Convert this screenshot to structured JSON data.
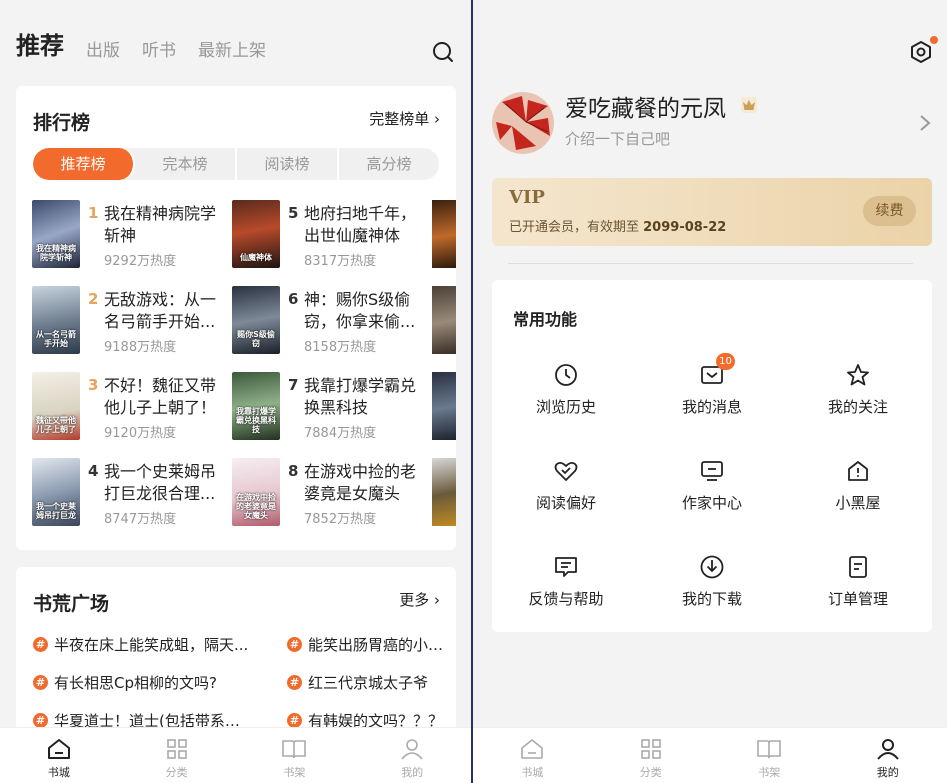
{
  "left": {
    "tabs": [
      {
        "label": "推荐",
        "active": true
      },
      {
        "label": "出版",
        "active": false
      },
      {
        "label": "听书",
        "active": false
      },
      {
        "label": "最新上架",
        "active": false
      }
    ],
    "ranking": {
      "title": "排行榜",
      "full_list": "完整榜单",
      "subtabs": [
        "推荐榜",
        "完本榜",
        "阅读榜",
        "高分榜"
      ],
      "books": [
        {
          "rank": "1",
          "title": "我在精神病院学斩神",
          "heat": "9292万热度",
          "cover_text": "我在精神病院学斩神"
        },
        {
          "rank": "2",
          "title": "无敌游戏：从一名弓箭手开始...",
          "heat": "9188万热度",
          "cover_text": "从一名弓箭手开始"
        },
        {
          "rank": "3",
          "title": "不好！魏征又带他儿子上朝了！",
          "heat": "9120万热度",
          "cover_text": "魏征又带他儿子上朝了"
        },
        {
          "rank": "4",
          "title": "我一个史莱姆吊打巨龙很合理...",
          "heat": "8747万热度",
          "cover_text": "我一个史莱姆吊打巨龙"
        },
        {
          "rank": "5",
          "title": "地府扫地千年，出世仙魔神体",
          "heat": "8317万热度",
          "cover_text": "仙魔神体"
        },
        {
          "rank": "6",
          "title": "神：赐你S级偷窃，你拿来偷...",
          "heat": "8158万热度",
          "cover_text": "赐你S级偷窃"
        },
        {
          "rank": "7",
          "title": "我靠打爆学霸兑换黑科技",
          "heat": "7884万热度",
          "cover_text": "我靠打爆学霸兑换黑科技"
        },
        {
          "rank": "8",
          "title": "在游戏中捡的老婆竟是女魔头",
          "heat": "7852万热度",
          "cover_text": "在游戏中捡的老婆竟是女魔头"
        }
      ]
    },
    "square": {
      "title": "书荒广场",
      "more": "更多",
      "topics": [
        "半夜在床上能笑成蛆，隔天...",
        "能笑出肠胃癌的小说，",
        "有长相思Cp相柳的文吗?",
        "红三代京城太子爷",
        "华夏道士！道士(包括带系统...",
        "有韩娱的文吗？？？"
      ]
    },
    "tabbar": [
      {
        "label": "书城",
        "active": true
      },
      {
        "label": "分类",
        "active": false
      },
      {
        "label": "书架",
        "active": false
      },
      {
        "label": "我的",
        "active": false
      }
    ]
  },
  "right": {
    "profile": {
      "name": "爱吃藏餐的元凤",
      "intro": "介绍一下自己吧"
    },
    "vip": {
      "title": "VIP",
      "desc_prefix": "已开通会员，有效期至 ",
      "expiry": "2099-08-22",
      "renew": "续费"
    },
    "functions": {
      "title": "常用功能",
      "items": [
        {
          "label": "浏览历史",
          "icon": "clock-icon"
        },
        {
          "label": "我的消息",
          "icon": "message-icon",
          "badge": "10"
        },
        {
          "label": "我的关注",
          "icon": "star-icon"
        },
        {
          "label": "阅读偏好",
          "icon": "heart-icon"
        },
        {
          "label": "作家中心",
          "icon": "monitor-icon"
        },
        {
          "label": "小黑屋",
          "icon": "house-icon"
        },
        {
          "label": "反馈与帮助",
          "icon": "feedback-icon"
        },
        {
          "label": "我的下载",
          "icon": "download-icon"
        },
        {
          "label": "订单管理",
          "icon": "order-icon"
        }
      ]
    },
    "tabbar": [
      {
        "label": "书城",
        "active": false
      },
      {
        "label": "分类",
        "active": false
      },
      {
        "label": "书架",
        "active": false
      },
      {
        "label": "我的",
        "active": true
      }
    ]
  },
  "colors": {
    "accent": "#f26b2d",
    "vip_gold": "#ebd3a8",
    "divider": "#2b2f63"
  }
}
